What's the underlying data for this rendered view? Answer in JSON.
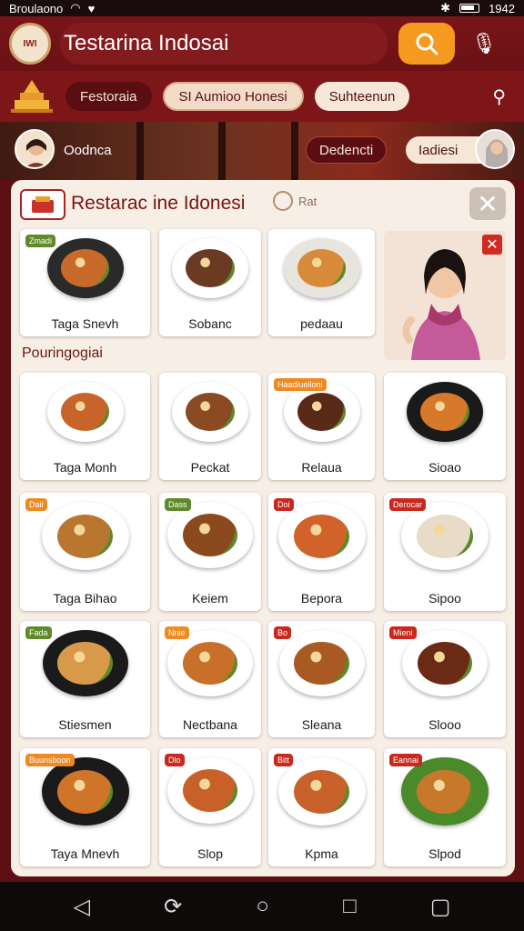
{
  "status": {
    "carrier": "Broulaono",
    "time": "1942"
  },
  "app": {
    "logo_text": "IWI",
    "title": "Testarina Indosai"
  },
  "filters": [
    "Festoraia",
    "SI Aumioo Honesi",
    "Suhteenun"
  ],
  "hero": {
    "left_chip": "Oodnca",
    "mid_chip": "Dedencti",
    "right_chip": "Iadiesi"
  },
  "panel": {
    "title": "Restarac ine Idonesi",
    "radio_label": "Rat",
    "section_label": "Pouringogiai"
  },
  "rows": [
    [
      {
        "name": "Taga Snevh",
        "tag": "Zmadi",
        "tag_color": "green",
        "plate": "#2a2a2a",
        "food": "#c86a2a"
      },
      {
        "name": "Sobanc",
        "tag": "",
        "plate": "#ffffff",
        "food": "#6a3a22"
      },
      {
        "name": "pedaau",
        "tag": "",
        "plate": "#e8e4de",
        "food": "#d68a3a"
      }
    ],
    [
      {
        "name": "Taga Monh",
        "tag": "",
        "plate": "#ffffff",
        "food": "#c8642a"
      },
      {
        "name": "Peckat",
        "tag": "",
        "plate": "#ffffff",
        "food": "#8a4a22"
      },
      {
        "name": "Relaua",
        "tag": "Haadiuelloni",
        "tag_color": "orange",
        "plate": "#ffffff",
        "food": "#5a2a18"
      },
      {
        "name": "Sioao",
        "tag": "",
        "plate": "#1a1a1a",
        "food": "#d8782a"
      }
    ],
    [
      {
        "name": "Taga Bihao",
        "tag": "Daii",
        "tag_color": "orange",
        "plate": "#ffffff",
        "food": "#b8762e"
      },
      {
        "name": "Keiem",
        "tag": "Dass",
        "tag_color": "green",
        "plate": "#ffffff",
        "food": "#8a4a1e"
      },
      {
        "name": "Bepora",
        "tag": "Doi",
        "tag_color": "red",
        "plate": "#ffffff",
        "food": "#d0622a"
      },
      {
        "name": "Sipoo",
        "tag": "Derocar",
        "tag_color": "red",
        "plate": "#ffffff",
        "food": "#e8dcc8"
      }
    ],
    [
      {
        "name": "Stiesmen",
        "tag": "Fada",
        "tag_color": "green",
        "plate": "#1a1a1a",
        "food": "#d89a4a"
      },
      {
        "name": "Nectbana",
        "tag": "Nnie",
        "tag_color": "orange",
        "plate": "#ffffff",
        "food": "#c8702a"
      },
      {
        "name": "Sleana",
        "tag": "Bo",
        "tag_color": "red",
        "plate": "#ffffff",
        "food": "#a85a22"
      },
      {
        "name": "Slooo",
        "tag": "Mieni",
        "tag_color": "red",
        "plate": "#ffffff",
        "food": "#6a2a16"
      }
    ],
    [
      {
        "name": "Taya Mnevh",
        "tag": "Buunsboon",
        "tag_color": "orange",
        "plate": "#1a1a1a",
        "food": "#d0742a"
      },
      {
        "name": "Slop",
        "tag": "Dlo",
        "tag_color": "red",
        "plate": "#ffffff",
        "food": "#c8602a"
      },
      {
        "name": "Kpma",
        "tag": "Bitt",
        "tag_color": "red",
        "plate": "#ffffff",
        "food": "#c8622a"
      },
      {
        "name": "Slpod",
        "tag": "Eannai",
        "tag_color": "red",
        "plate": "#4a8a2a",
        "food": "#c8782a"
      }
    ]
  ],
  "colors": {
    "brand": "#7a1418",
    "accent": "#f59a1e",
    "panel": "#f7efe6"
  }
}
